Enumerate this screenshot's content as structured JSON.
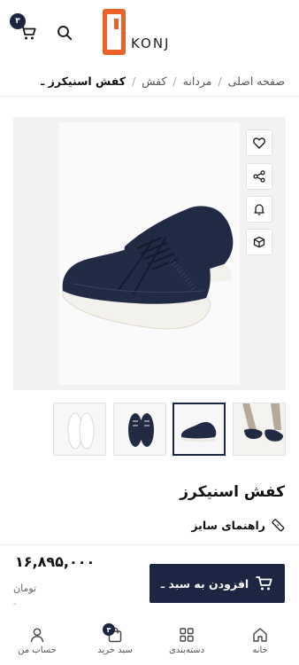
{
  "header": {
    "cart_count": "۳",
    "logo_text": "KONJ"
  },
  "breadcrumb": {
    "items": [
      "صفحه اصلی",
      "مردانه",
      "کفش"
    ],
    "current": "کفش اسنیکرز ـ"
  },
  "product": {
    "title": "کفش اسنیکرز",
    "size_guide": "راهنمای سایز",
    "price": "۱۶,۸۹۵,۰۰۰",
    "currency": "تومان",
    "price_note": "-",
    "add_to_cart": "افزودن به سبد ـ"
  },
  "gallery": {
    "thumbnails": [
      "worn-on-feet",
      "side-view",
      "pair-view",
      "sole-view"
    ],
    "active_thumbnail": 1
  },
  "bottom_nav": {
    "home": "خانه",
    "categories": "دسته‌بندی",
    "cart": "سبد خرید",
    "cart_count": "۳",
    "account": "حساب من"
  },
  "colors": {
    "primary": "#1c2541",
    "logo": "#e9622a",
    "gallery_bg": "#f2f2f2"
  }
}
